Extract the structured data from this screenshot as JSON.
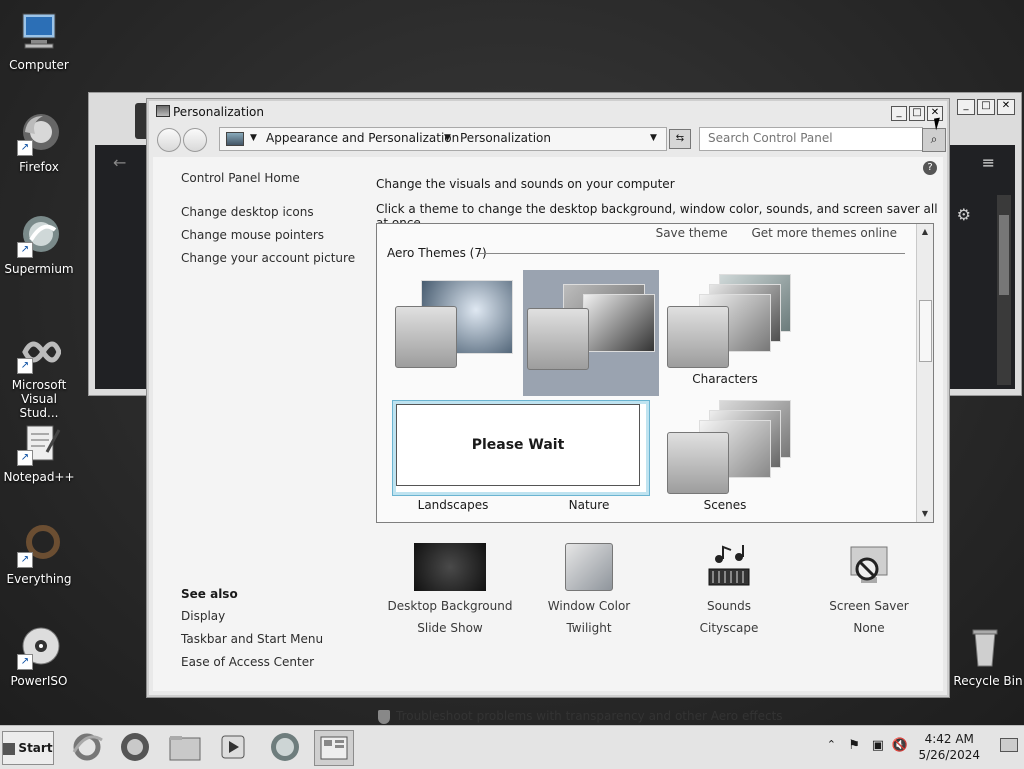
{
  "desktop_icons": [
    {
      "label": "Computer",
      "icon": "computer-icon"
    },
    {
      "label": "Firefox",
      "icon": "firefox-icon"
    },
    {
      "label": "Supermium",
      "icon": "supermium-icon"
    },
    {
      "label": "Microsoft Visual Stud...",
      "icon": "visual-studio-icon"
    },
    {
      "label": "Notepad++",
      "icon": "notepadpp-icon"
    },
    {
      "label": "Everything",
      "icon": "everything-icon"
    },
    {
      "label": "PowerISO",
      "icon": "poweriso-icon"
    },
    {
      "label": "Recycle Bin",
      "icon": "recycle-bin-icon"
    }
  ],
  "window": {
    "title": "Personalization",
    "breadcrumbs": [
      "Appearance and Personalization",
      "Personalization"
    ],
    "search_placeholder": "Search Control Panel"
  },
  "left_nav": {
    "home": "Control Panel Home",
    "links": [
      "Change desktop icons",
      "Change mouse pointers",
      "Change your account picture"
    ]
  },
  "see_also": {
    "heading": "See also",
    "links": [
      "Display",
      "Taskbar and Start Menu",
      "Ease of Access Center"
    ]
  },
  "main": {
    "headline": "Change the visuals and sounds on your computer",
    "subline": "Click a theme to change the desktop background, window color, sounds, and screen saver all at once.",
    "save_theme": "Save theme",
    "get_more": "Get more themes online",
    "group_heading": "Aero Themes (7)",
    "themes": [
      "",
      "",
      "Characters",
      "Landscapes",
      "Nature",
      "Scenes"
    ],
    "please_wait": "Please Wait"
  },
  "bottom": [
    {
      "label": "Desktop Background",
      "sub": "Slide Show",
      "icon": "desktop-background-icon"
    },
    {
      "label": "Window Color",
      "sub": "Twilight",
      "icon": "window-color-icon"
    },
    {
      "label": "Sounds",
      "sub": "Cityscape",
      "icon": "sounds-icon"
    },
    {
      "label": "Screen Saver",
      "sub": "None",
      "icon": "screen-saver-icon"
    }
  ],
  "troubleshoot": "Troubleshoot problems with transparency and other Aero effects",
  "taskbar": {
    "start": "Start",
    "time": "4:42 AM",
    "date": "5/26/2024"
  }
}
